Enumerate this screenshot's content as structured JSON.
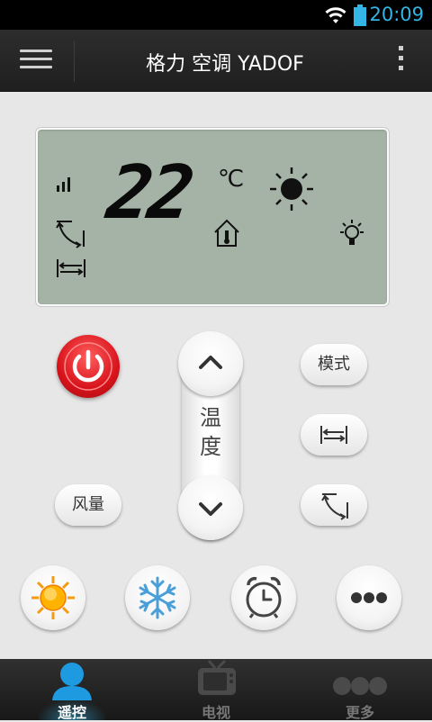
{
  "status_bar": {
    "time": "20:09"
  },
  "header": {
    "title": "格力 空调 YADOF"
  },
  "display": {
    "temperature": "22",
    "unit": "℃"
  },
  "controls": {
    "temp_label_1": "温",
    "temp_label_2": "度",
    "mode_label": "模式",
    "fan_label": "风量"
  },
  "bottom_nav": {
    "items": [
      {
        "label": "遥控",
        "active": true
      },
      {
        "label": "电视",
        "active": false
      },
      {
        "label": "更多",
        "active": false
      }
    ]
  },
  "colors": {
    "accent": "#33b5e5",
    "power": "#d8131b",
    "lcd": "#a5b3a6"
  }
}
